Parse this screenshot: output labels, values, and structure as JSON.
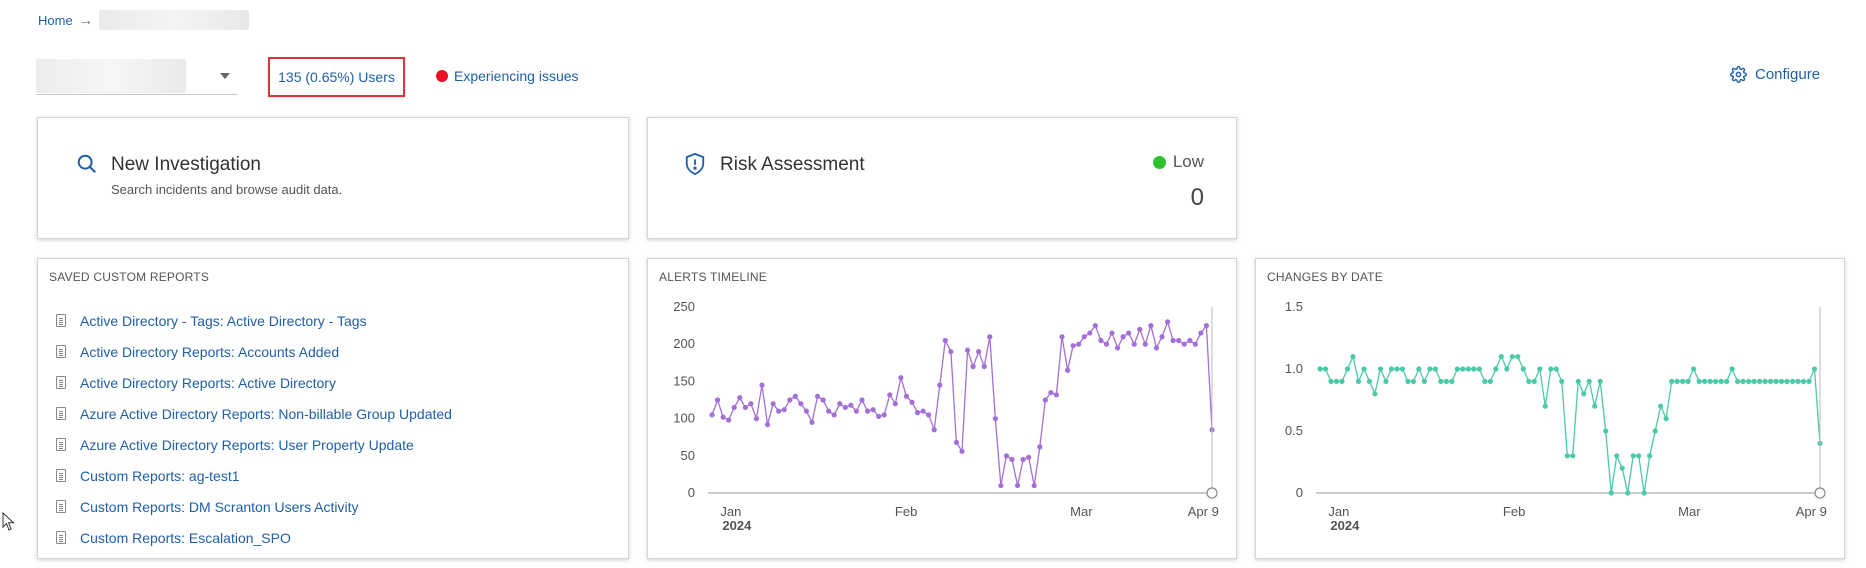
{
  "breadcrumb": {
    "home": "Home",
    "arrow": "→"
  },
  "header": {
    "users_label": "135 (0.65%) Users",
    "issues_label": "Experiencing issues",
    "issues_color": "#e81123",
    "configure_label": "Configure"
  },
  "investigation": {
    "title": "New Investigation",
    "subtitle": "Search incidents and browse audit data."
  },
  "risk": {
    "title": "Risk Assessment",
    "level": "Low",
    "level_color": "#2ec12e",
    "value": "0"
  },
  "reports": {
    "heading": "SAVED CUSTOM REPORTS",
    "items": [
      "Active Directory - Tags: Active Directory - Tags",
      "Active Directory Reports: Accounts Added",
      "Active Directory Reports: Active Directory",
      "Azure Active Directory Reports: Non-billable Group Updated",
      "Azure Active Directory Reports: User Property Update",
      "Custom Reports: ag-test1",
      "Custom Reports: DM Scranton Users Activity",
      "Custom Reports: Escalation_SPO"
    ]
  },
  "alerts_timeline": {
    "heading": "ALERTS TIMELINE"
  },
  "changes_by_date": {
    "heading": "CHANGES BY DATE"
  },
  "chart_data": [
    {
      "type": "line",
      "title": "ALERTS TIMELINE",
      "color": "#a46fd6",
      "x_ticks": [
        "Jan",
        "Feb",
        "Mar",
        "Apr 9"
      ],
      "x_subtick": "2024",
      "y_ticks": [
        "0",
        "50",
        "100",
        "150",
        "200",
        "250"
      ],
      "ylim": [
        0,
        250
      ],
      "values": [
        105,
        125,
        102,
        98,
        115,
        128,
        115,
        120,
        100,
        145,
        92,
        120,
        110,
        112,
        125,
        130,
        120,
        110,
        95,
        130,
        125,
        110,
        105,
        120,
        115,
        118,
        110,
        125,
        110,
        112,
        103,
        105,
        132,
        120,
        155,
        130,
        122,
        108,
        110,
        105,
        85,
        145,
        205,
        190,
        68,
        56,
        192,
        170,
        190,
        170,
        210,
        100,
        10,
        50,
        45,
        10,
        45,
        48,
        10,
        62,
        125,
        135,
        132,
        210,
        165,
        198,
        200,
        210,
        215,
        225,
        205,
        200,
        215,
        195,
        210,
        215,
        200,
        220,
        200,
        225,
        195,
        210,
        230,
        205,
        205,
        200,
        205,
        200,
        215,
        225,
        85
      ]
    },
    {
      "type": "line",
      "title": "CHANGES BY DATE",
      "color": "#4cc9a8",
      "x_ticks": [
        "Jan",
        "Feb",
        "Mar",
        "Apr 9"
      ],
      "x_subtick": "2024",
      "y_ticks": [
        "0",
        "0.5",
        "1.0",
        "1.5"
      ],
      "ylim": [
        0,
        1.5
      ],
      "values": [
        1.0,
        1.0,
        0.9,
        0.9,
        0.9,
        1.0,
        1.1,
        0.9,
        1.0,
        0.9,
        0.8,
        1.0,
        0.9,
        1.0,
        1.0,
        1.0,
        0.9,
        0.9,
        1.0,
        0.9,
        1.0,
        1.0,
        0.9,
        0.9,
        0.9,
        1.0,
        1.0,
        1.0,
        1.0,
        1.0,
        0.9,
        0.9,
        1.0,
        1.1,
        1.0,
        1.1,
        1.1,
        1.0,
        0.9,
        0.9,
        1.0,
        0.7,
        1.0,
        1.0,
        0.9,
        0.3,
        0.3,
        0.9,
        0.8,
        0.9,
        0.7,
        0.9,
        0.5,
        0.0,
        0.3,
        0.2,
        0.0,
        0.3,
        0.3,
        0.0,
        0.3,
        0.5,
        0.7,
        0.6,
        0.9,
        0.9,
        0.9,
        0.9,
        1.0,
        0.9,
        0.9,
        0.9,
        0.9,
        0.9,
        0.9,
        1.0,
        0.9,
        0.9,
        0.9,
        0.9,
        0.9,
        0.9,
        0.9,
        0.9,
        0.9,
        0.9,
        0.9,
        0.9,
        0.9,
        0.9,
        1.0,
        0.4
      ]
    }
  ]
}
